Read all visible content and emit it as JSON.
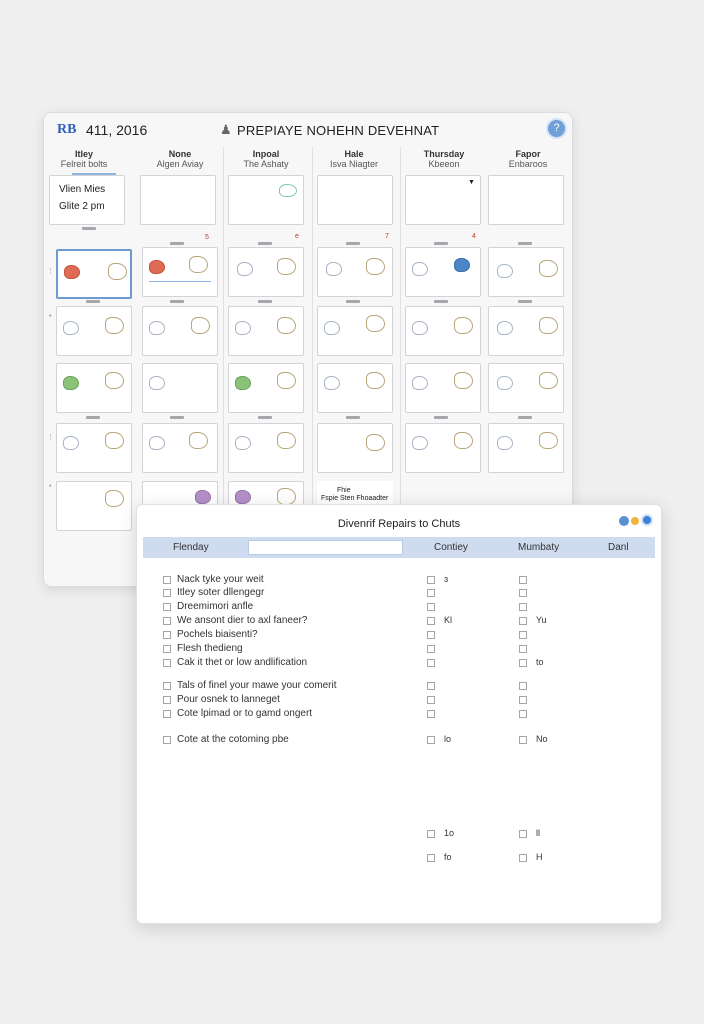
{
  "calendar": {
    "logo": "RB",
    "date": "411, 2016",
    "title": "PREPIAYE NOHEHN DEVEHNAT",
    "help_label": "?",
    "columns": [
      {
        "day": "Itley",
        "sub": "Felreit bolts"
      },
      {
        "day": "None",
        "sub": "Algen Aviay"
      },
      {
        "day": "Inpoal",
        "sub": "The Ashaty"
      },
      {
        "day": "Hale",
        "sub": "Isva Niagter"
      },
      {
        "day": "Thursday",
        "sub": "Kbeeon"
      },
      {
        "day": "Fapor",
        "sub": "Enbaroos"
      }
    ],
    "top_cell": {
      "line1": "Vlien Mies",
      "line2": "Glite 2 pm"
    },
    "red_marks": [
      "5",
      "e",
      "7",
      "4"
    ],
    "last_cell": {
      "line1": "Fhie",
      "line2": "Fspie Sten Fhoaadter"
    }
  },
  "dialog": {
    "title": "Divenrif Repairs to Chuts",
    "header": {
      "col1": "Flenday",
      "search_value": "",
      "col2": "Contiey",
      "col3": "Mumbaty",
      "col4": "Danl"
    },
    "rows": [
      {
        "label": "Nack tyke your weit",
        "v1": "ɜ",
        "v2": ""
      },
      {
        "label": "Itley soter dllengegr",
        "v1": "",
        "v2": ""
      },
      {
        "label": "Dreemimori anfle",
        "v1": "",
        "v2": ""
      },
      {
        "label": "We ansont dier to axl faneer?",
        "v1": "Kl",
        "v2": "Yu"
      },
      {
        "label": "Pochels biaisenti?",
        "v1": "",
        "v2": ""
      },
      {
        "label": "Flesh thedieng",
        "v1": "",
        "v2": ""
      },
      {
        "label": "Cak it thet or low andlification",
        "v1": "",
        "v2": "to"
      },
      {
        "label": "Tals of finel your mawe your comerit",
        "v1": "",
        "v2": ""
      },
      {
        "label": "Pour osnek to lanneget",
        "v1": "",
        "v2": ""
      },
      {
        "label": "Cote lpimad or to gamd ongert",
        "v1": "",
        "v2": ""
      },
      {
        "label": "Cote at the cotoming pbe",
        "v1": "lo",
        "v2": "No"
      },
      {
        "label": "",
        "v1": "1o",
        "v2": "ll"
      },
      {
        "label": "",
        "v1": "fo",
        "v2": "H"
      }
    ]
  }
}
